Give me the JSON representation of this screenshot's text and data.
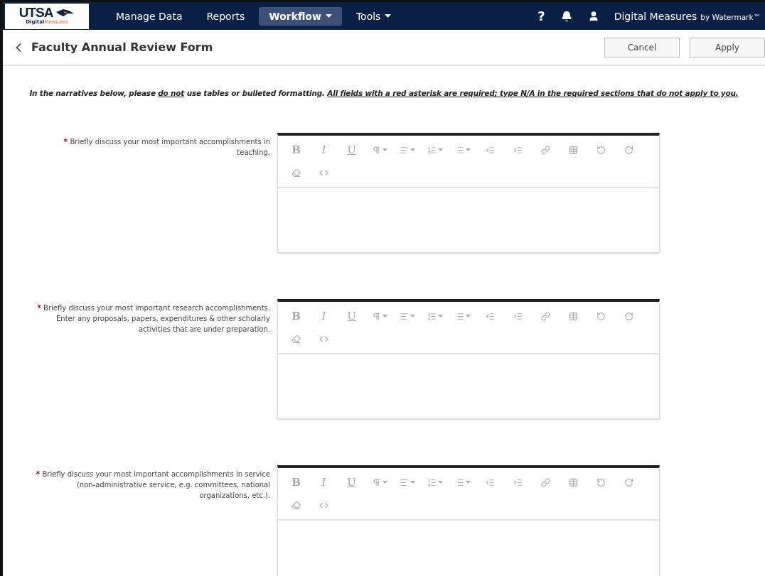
{
  "nav": {
    "logo": {
      "title": "UTSA",
      "sub_1": "Digital",
      "sub_2": "Measures"
    },
    "menu": [
      {
        "label": "Manage Data",
        "selected": false,
        "has_menu": false
      },
      {
        "label": "Reports",
        "selected": false,
        "has_menu": false
      },
      {
        "label": "Workflow",
        "selected": true,
        "has_menu": true
      },
      {
        "label": "Tools",
        "selected": false,
        "has_menu": true
      }
    ],
    "help": "?",
    "brand": "Digital Measures",
    "brand_sub": "by Watermark™"
  },
  "header": {
    "title": "Faculty Annual Review Form",
    "buttons": [
      "Cancel",
      "Apply"
    ]
  },
  "instructions": [
    {
      "text": "In the narratives below, please ",
      "underline": false
    },
    {
      "text": "do not",
      "underline": true
    },
    {
      "text": " use tables or bulleted formatting. ",
      "underline": false
    },
    {
      "text": "All fields with a red asterisk are required; type N/A in the required sections that do not apply to you.",
      "underline": true
    }
  ],
  "fields": [
    {
      "required": true,
      "asterisk": "*",
      "label": "Briefly discuss your most important accomplishments in teaching.",
      "toolbar": [
        {
          "kind": "bold",
          "glyph": "B"
        },
        {
          "kind": "italic",
          "glyph": "I"
        },
        {
          "kind": "underline",
          "glyph": "U"
        },
        {
          "kind": "paragraph"
        },
        {
          "kind": "align"
        },
        {
          "kind": "ordered"
        },
        {
          "kind": "bullets"
        },
        {
          "kind": "outdent"
        },
        {
          "kind": "indent"
        },
        {
          "kind": "link"
        },
        {
          "kind": "table"
        },
        {
          "kind": "undo"
        },
        {
          "kind": "redo"
        },
        {
          "kind": "eraser"
        },
        {
          "kind": "code"
        }
      ]
    },
    {
      "required": true,
      "asterisk": "*",
      "label": "Briefly discuss your most important research accomplishments. Enter any proposals, papers, expenditures & other scholarly activities that are under preparation.",
      "toolbar": [
        {
          "kind": "bold",
          "glyph": "B"
        },
        {
          "kind": "italic",
          "glyph": "I"
        },
        {
          "kind": "underline",
          "glyph": "U"
        },
        {
          "kind": "paragraph"
        },
        {
          "kind": "align"
        },
        {
          "kind": "ordered"
        },
        {
          "kind": "bullets"
        },
        {
          "kind": "outdent"
        },
        {
          "kind": "indent"
        },
        {
          "kind": "link"
        },
        {
          "kind": "table"
        },
        {
          "kind": "undo"
        },
        {
          "kind": "redo"
        },
        {
          "kind": "eraser"
        },
        {
          "kind": "code"
        }
      ]
    },
    {
      "required": true,
      "asterisk": "*",
      "label": "Briefly discuss your most important accomplishments in service (non-administrative service, e.g. committees, national organizations, etc.).",
      "toolbar": [
        {
          "kind": "bold",
          "glyph": "B"
        },
        {
          "kind": "italic",
          "glyph": "I"
        },
        {
          "kind": "underline",
          "glyph": "U"
        },
        {
          "kind": "paragraph"
        },
        {
          "kind": "align"
        },
        {
          "kind": "ordered"
        },
        {
          "kind": "bullets"
        },
        {
          "kind": "outdent"
        },
        {
          "kind": "indent"
        },
        {
          "kind": "link"
        },
        {
          "kind": "table"
        },
        {
          "kind": "undo"
        },
        {
          "kind": "redo"
        },
        {
          "kind": "eraser"
        },
        {
          "kind": "code"
        }
      ]
    }
  ]
}
